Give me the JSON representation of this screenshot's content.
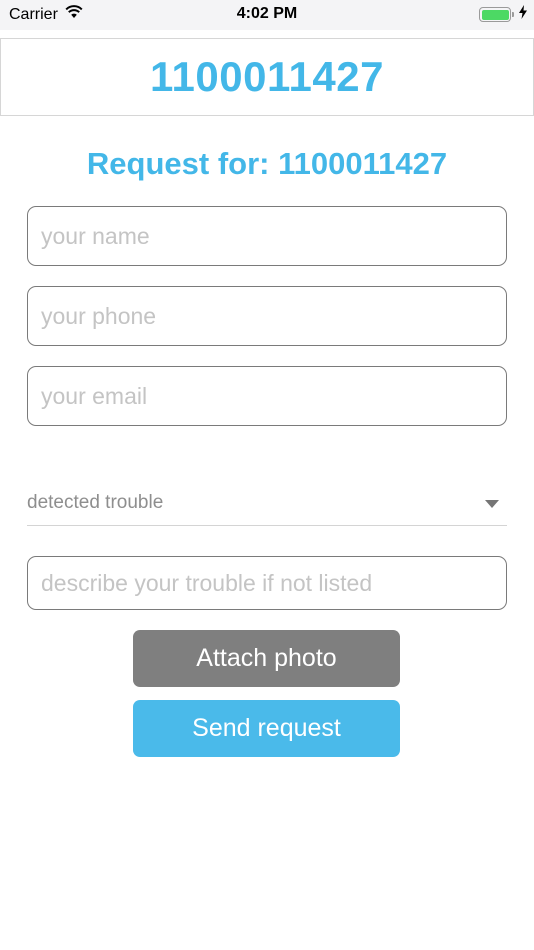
{
  "status_bar": {
    "carrier": "Carrier",
    "time": "4:02 PM",
    "battery_level": 1.0,
    "battery_color": "#4cd964"
  },
  "header": {
    "title": "1100011427"
  },
  "form": {
    "title": "Request for: 1100011427",
    "name_placeholder": "your name",
    "name_value": "",
    "phone_placeholder": "your phone",
    "phone_value": "",
    "email_placeholder": "your email",
    "email_value": "",
    "trouble_select_label": "detected trouble",
    "description_placeholder": "describe your trouble if not listed",
    "description_value": ""
  },
  "buttons": {
    "attach_label": "Attach photo",
    "send_label": "Send request"
  },
  "colors": {
    "accent": "#43b7e8",
    "attach_button": "#7f7f7f",
    "send_button": "#4abaea"
  },
  "icons": {
    "wifi": "wifi-icon",
    "charging": "charging-bolt-icon",
    "battery": "battery-icon",
    "dropdown": "caret-down-icon"
  }
}
